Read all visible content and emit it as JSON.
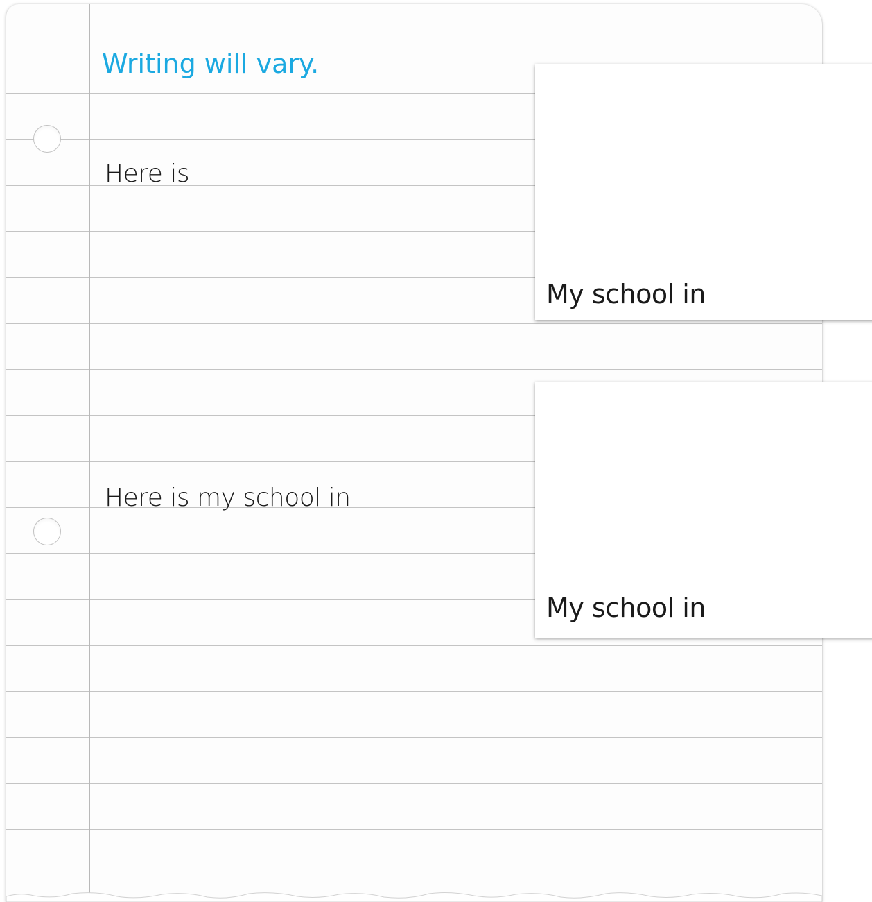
{
  "worksheet": {
    "answer_note": "Writing will vary.",
    "prompt_1": "Here is",
    "prompt_2": "Here is my school in"
  },
  "cards": [
    {
      "caption": "My school in"
    },
    {
      "caption": "My school in"
    }
  ],
  "colors": {
    "answer_text": "#1ba9e1",
    "rule_lines": "#c4c4c4",
    "paper": "#fdfdfd"
  }
}
